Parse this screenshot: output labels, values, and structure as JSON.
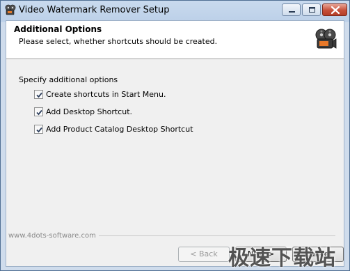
{
  "window": {
    "title": "Video Watermark Remover Setup"
  },
  "header": {
    "title": "Additional Options",
    "subtitle": "Please select, whether shortcuts should be created."
  },
  "options": {
    "group_label": "Specify additional options",
    "items": [
      {
        "label": "Create shortcuts in Start Menu.",
        "checked": true
      },
      {
        "label": "Add Desktop Shortcut.",
        "checked": true
      },
      {
        "label": "Add Product Catalog Desktop Shortcut",
        "checked": true
      }
    ]
  },
  "footer": {
    "brand": "www.4dots-software.com",
    "back_label": "< Back",
    "next_label": "Next >",
    "cancel_label": "Cancel"
  },
  "watermark": {
    "text": "极速下载站"
  },
  "icons": {
    "app": "film-reel-icon",
    "header": "film-reel-icon",
    "minimize": "minimize-icon",
    "maximize": "maximize-icon",
    "close": "close-icon"
  },
  "colors": {
    "close_button": "#c7503a",
    "titlebar": "#bcd0e8",
    "client": "#f0f0f0"
  }
}
